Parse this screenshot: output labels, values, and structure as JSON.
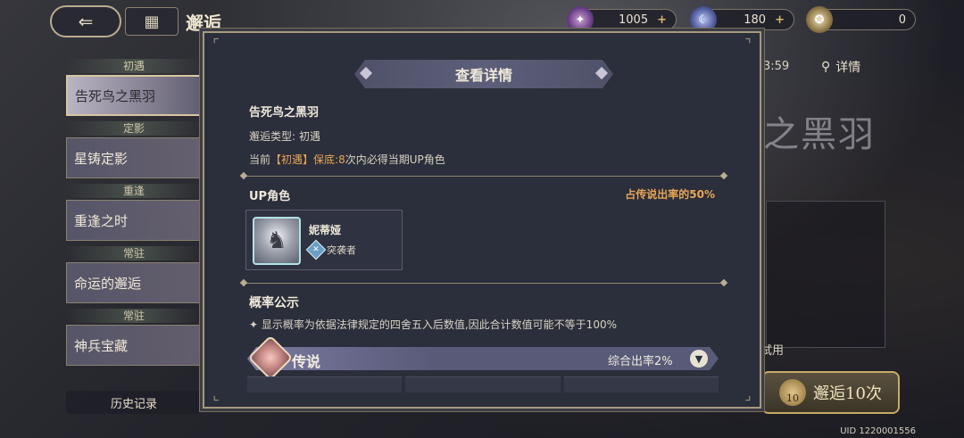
{
  "header": {
    "back_icon": "back-arrow-icon",
    "home_icon": "grid-home-icon",
    "title": "邂逅"
  },
  "currencies": [
    {
      "icon": "purple-crystal-icon",
      "value": "1005",
      "plus": "+"
    },
    {
      "icon": "moon-stone-icon",
      "value": "180",
      "plus": "+"
    },
    {
      "icon": "star-coin-icon",
      "value": "0"
    }
  ],
  "sidebar": {
    "categories": [
      {
        "label": "初遇",
        "banner": "告死鸟之黑羽",
        "active": true
      },
      {
        "label": "定影",
        "banner": "星铸定影"
      },
      {
        "label": "重逢",
        "banner": "重逢之时"
      },
      {
        "label": "常驻",
        "banner": "命运的邂逅"
      },
      {
        "label": "常驻",
        "banner": "神兵宝藏"
      }
    ],
    "history": "历史记录"
  },
  "right": {
    "timer": "3:59",
    "detail": "详情",
    "banner_title": "之黑羽",
    "trial": "试用",
    "summon_label": "邂逅10次",
    "summon_count": "10"
  },
  "uid": "UID 1220001556",
  "modal": {
    "title": "查看详情",
    "pool_name": "告死鸟之黑羽",
    "pool_type_label": "邂逅类型:",
    "pool_type_value": "初遇",
    "pity_prefix": "当前",
    "pity_highlight": "【初遇】保底:",
    "pity_number": "8",
    "pity_suffix": "次内必得当期UP角色",
    "up_label": "UP角色",
    "up_rate": "占传说出率的50%",
    "character": {
      "name": "妮蒂娅",
      "role": "突袭者",
      "role_icon": "assault-role-icon"
    },
    "prob_title": "概率公示",
    "prob_note": "✦ 显示概率为依据法律规定的四舍五入后数值,因此合计数值可能不等于100%",
    "legend_label": "传说",
    "legend_rate": "综合出率2%",
    "legend_icon": "legend-rarity-icon",
    "toggle_icon": "chevron-down-icon"
  }
}
